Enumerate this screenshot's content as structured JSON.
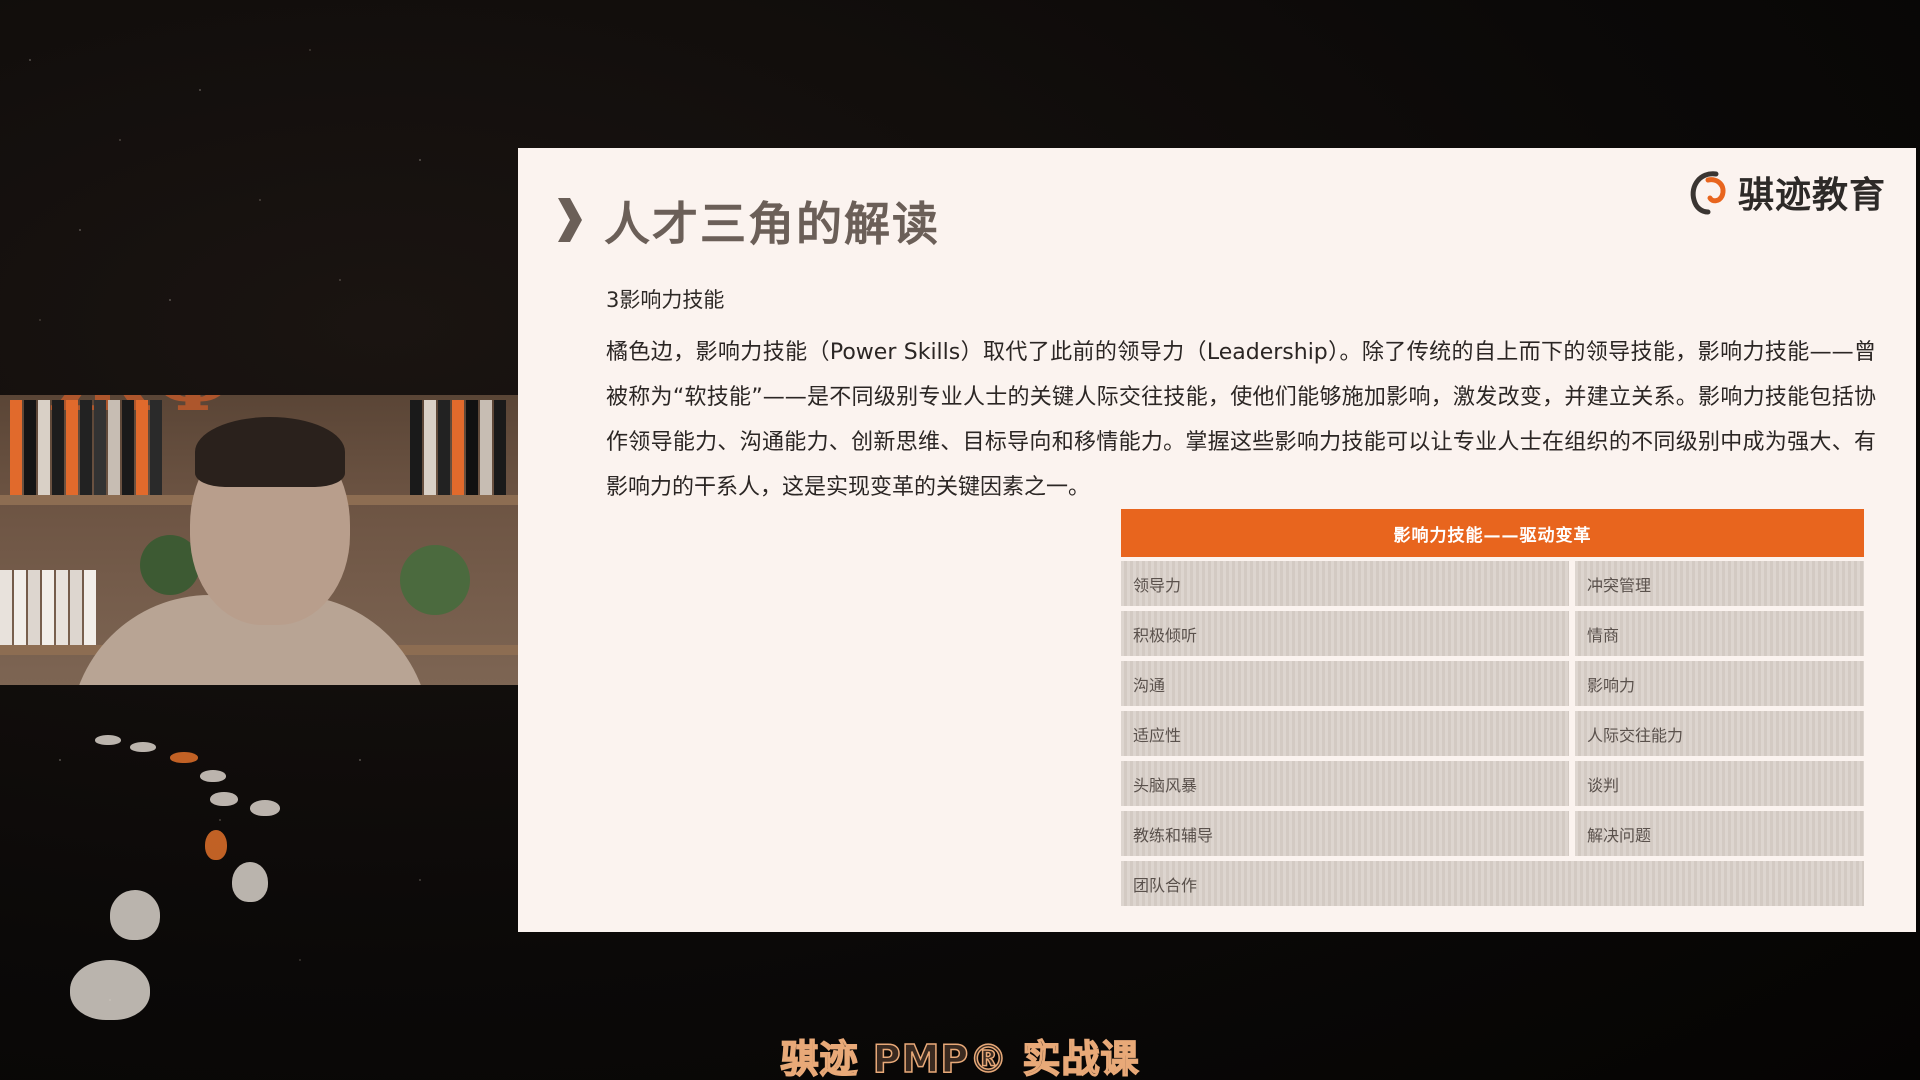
{
  "slide": {
    "title": "人才三角的解读",
    "logo_text": "骐迹教育",
    "subtitle": "3影响力技能",
    "paragraph": "橘色边，影响力技能（Power Skills）取代了此前的领导力（Leadership）。除了传统的自上而下的领导技能，影响力技能——曾被称为“软技能”——是不同级别专业人士的关键人际交往技能，使他们能够施加影响，激发改变，并建立关系。影响力技能包括协作领导能力、沟通能力、创新思维、目标导向和移情能力。掌握这些影响力技能可以让专业人士在组织的不同级别中成为强大、有影响力的干系人，这是实现变革的关键因素之一。",
    "table": {
      "header": "影响力技能——驱动变革",
      "rows": [
        {
          "left": "领导力",
          "right": "冲突管理"
        },
        {
          "left": "积极倾听",
          "right": "情商"
        },
        {
          "left": "沟通",
          "right": "影响力"
        },
        {
          "left": "适应性",
          "right": "人际交往能力"
        },
        {
          "left": "头脑风暴",
          "right": "谈判"
        },
        {
          "left": "教练和辅导",
          "right": "解决问题"
        }
      ],
      "last_row": "团队合作",
      "header_color": "#e8651e"
    }
  },
  "caption": "骐迹 PMP® 实战课",
  "icons": {
    "title_marker": "chevron-right-icon",
    "logo": "logo-icon"
  }
}
